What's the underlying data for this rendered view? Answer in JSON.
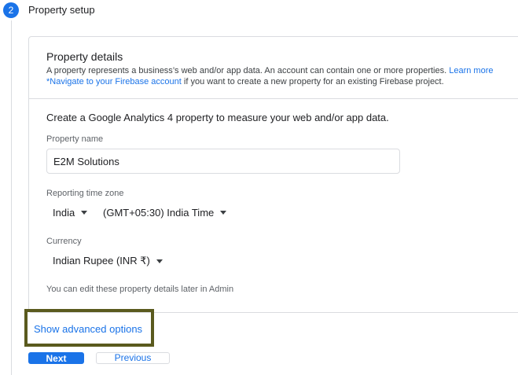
{
  "step": {
    "number": "2",
    "title": "Property setup"
  },
  "details": {
    "title": "Property details",
    "desc_text_1": "A property represents a business’s web and/or app data. An account can contain one or more properties.",
    "learn_more_link": "Learn more",
    "firebase_link": "*Navigate to your Firebase account",
    "desc_text_2": "if you want to create a new property for an existing Firebase project."
  },
  "form": {
    "intro": "Create a Google Analytics 4 property to measure your web and/or app data.",
    "property_name_label": "Property name",
    "property_name_value": "E2M Solutions",
    "timezone_label": "Reporting time zone",
    "country_value": "India",
    "timezone_value": "(GMT+05:30) India Time",
    "currency_label": "Currency",
    "currency_value": "Indian Rupee (INR ₹)",
    "note": "You can edit these property details later in Admin"
  },
  "advanced": {
    "label": "Show advanced options"
  },
  "buttons": {
    "next": "Next",
    "previous": "Previous"
  },
  "colors": {
    "accent": "#1a73e8",
    "highlight_border": "#5a5a1e"
  },
  "icons": {
    "dropdown": "caret-down-icon"
  }
}
